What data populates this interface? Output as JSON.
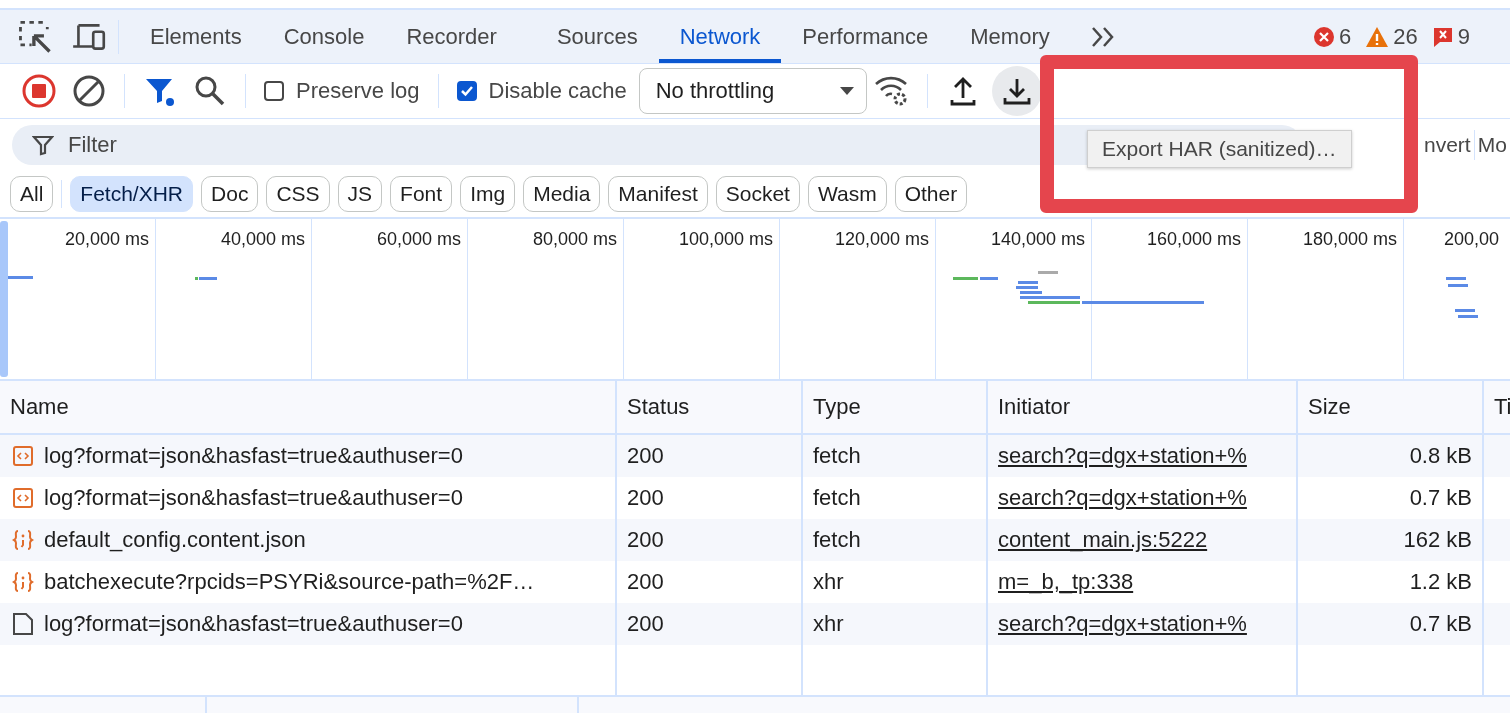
{
  "main_tabs": {
    "tabs": [
      {
        "label": "Elements",
        "selected": false
      },
      {
        "label": "Console",
        "selected": false
      },
      {
        "label": "Recorder",
        "selected": false
      },
      {
        "label": "Sources",
        "selected": false
      },
      {
        "label": "Network",
        "selected": true
      },
      {
        "label": "Performance",
        "selected": false
      },
      {
        "label": "Memory",
        "selected": false
      }
    ],
    "counters": {
      "errors": "6",
      "warnings": "26",
      "issues": "9"
    }
  },
  "toolbar": {
    "recording": true,
    "filter_bar_shown": true,
    "preserve_log": {
      "label": "Preserve log",
      "checked": false
    },
    "disable_cache": {
      "label": "Disable cache",
      "checked": true
    },
    "throttling": "No throttling",
    "export_hovered": true
  },
  "filter": {
    "placeholder": "Filter",
    "invert_label": "nvert",
    "more_label": "Mo"
  },
  "tooltip": "Export HAR (sanitized)…",
  "type_filters": [
    {
      "label": "All",
      "selected": false
    },
    {
      "label": "Fetch/XHR",
      "selected": true
    },
    {
      "label": "Doc",
      "selected": false
    },
    {
      "label": "CSS",
      "selected": false
    },
    {
      "label": "JS",
      "selected": false
    },
    {
      "label": "Font",
      "selected": false
    },
    {
      "label": "Img",
      "selected": false
    },
    {
      "label": "Media",
      "selected": false
    },
    {
      "label": "Manifest",
      "selected": false
    },
    {
      "label": "Socket",
      "selected": false
    },
    {
      "label": "Wasm",
      "selected": false
    },
    {
      "label": "Other",
      "selected": false
    }
  ],
  "overview": {
    "ticks": [
      "20,000 ms",
      "40,000 ms",
      "60,000 ms",
      "80,000 ms",
      "100,000 ms",
      "120,000 ms",
      "140,000 ms",
      "160,000 ms",
      "180,000 ms",
      "200,00"
    ]
  },
  "table": {
    "columns": [
      "Name",
      "Status",
      "Type",
      "Initiator",
      "Size",
      "Ti"
    ],
    "rows": [
      {
        "kind": "fetch",
        "name": "log?format=json&hasfast=true&authuser=0",
        "status": "200",
        "type": "fetch",
        "initiator": "search?q=dgx+station+%",
        "size": "0.8 kB"
      },
      {
        "kind": "fetch",
        "name": "log?format=json&hasfast=true&authuser=0",
        "status": "200",
        "type": "fetch",
        "initiator": "search?q=dgx+station+%",
        "size": "0.7 kB"
      },
      {
        "kind": "json",
        "name": "default_config.content.json",
        "status": "200",
        "type": "fetch",
        "initiator": "content_main.js:5222",
        "size": "162 kB"
      },
      {
        "kind": "json",
        "name": "batchexecute?rpcids=PSYRi&source-path=%2F…",
        "status": "200",
        "type": "xhr",
        "initiator": "m=_b,_tp:338",
        "size": "1.2 kB"
      },
      {
        "kind": "document",
        "name": "log?format=json&hasfast=true&authuser=0",
        "status": "200",
        "type": "xhr",
        "initiator": "search?q=dgx+station+%",
        "size": "0.7 kB"
      }
    ]
  },
  "annotations": [
    {
      "kind": "rectangle"
    }
  ]
}
